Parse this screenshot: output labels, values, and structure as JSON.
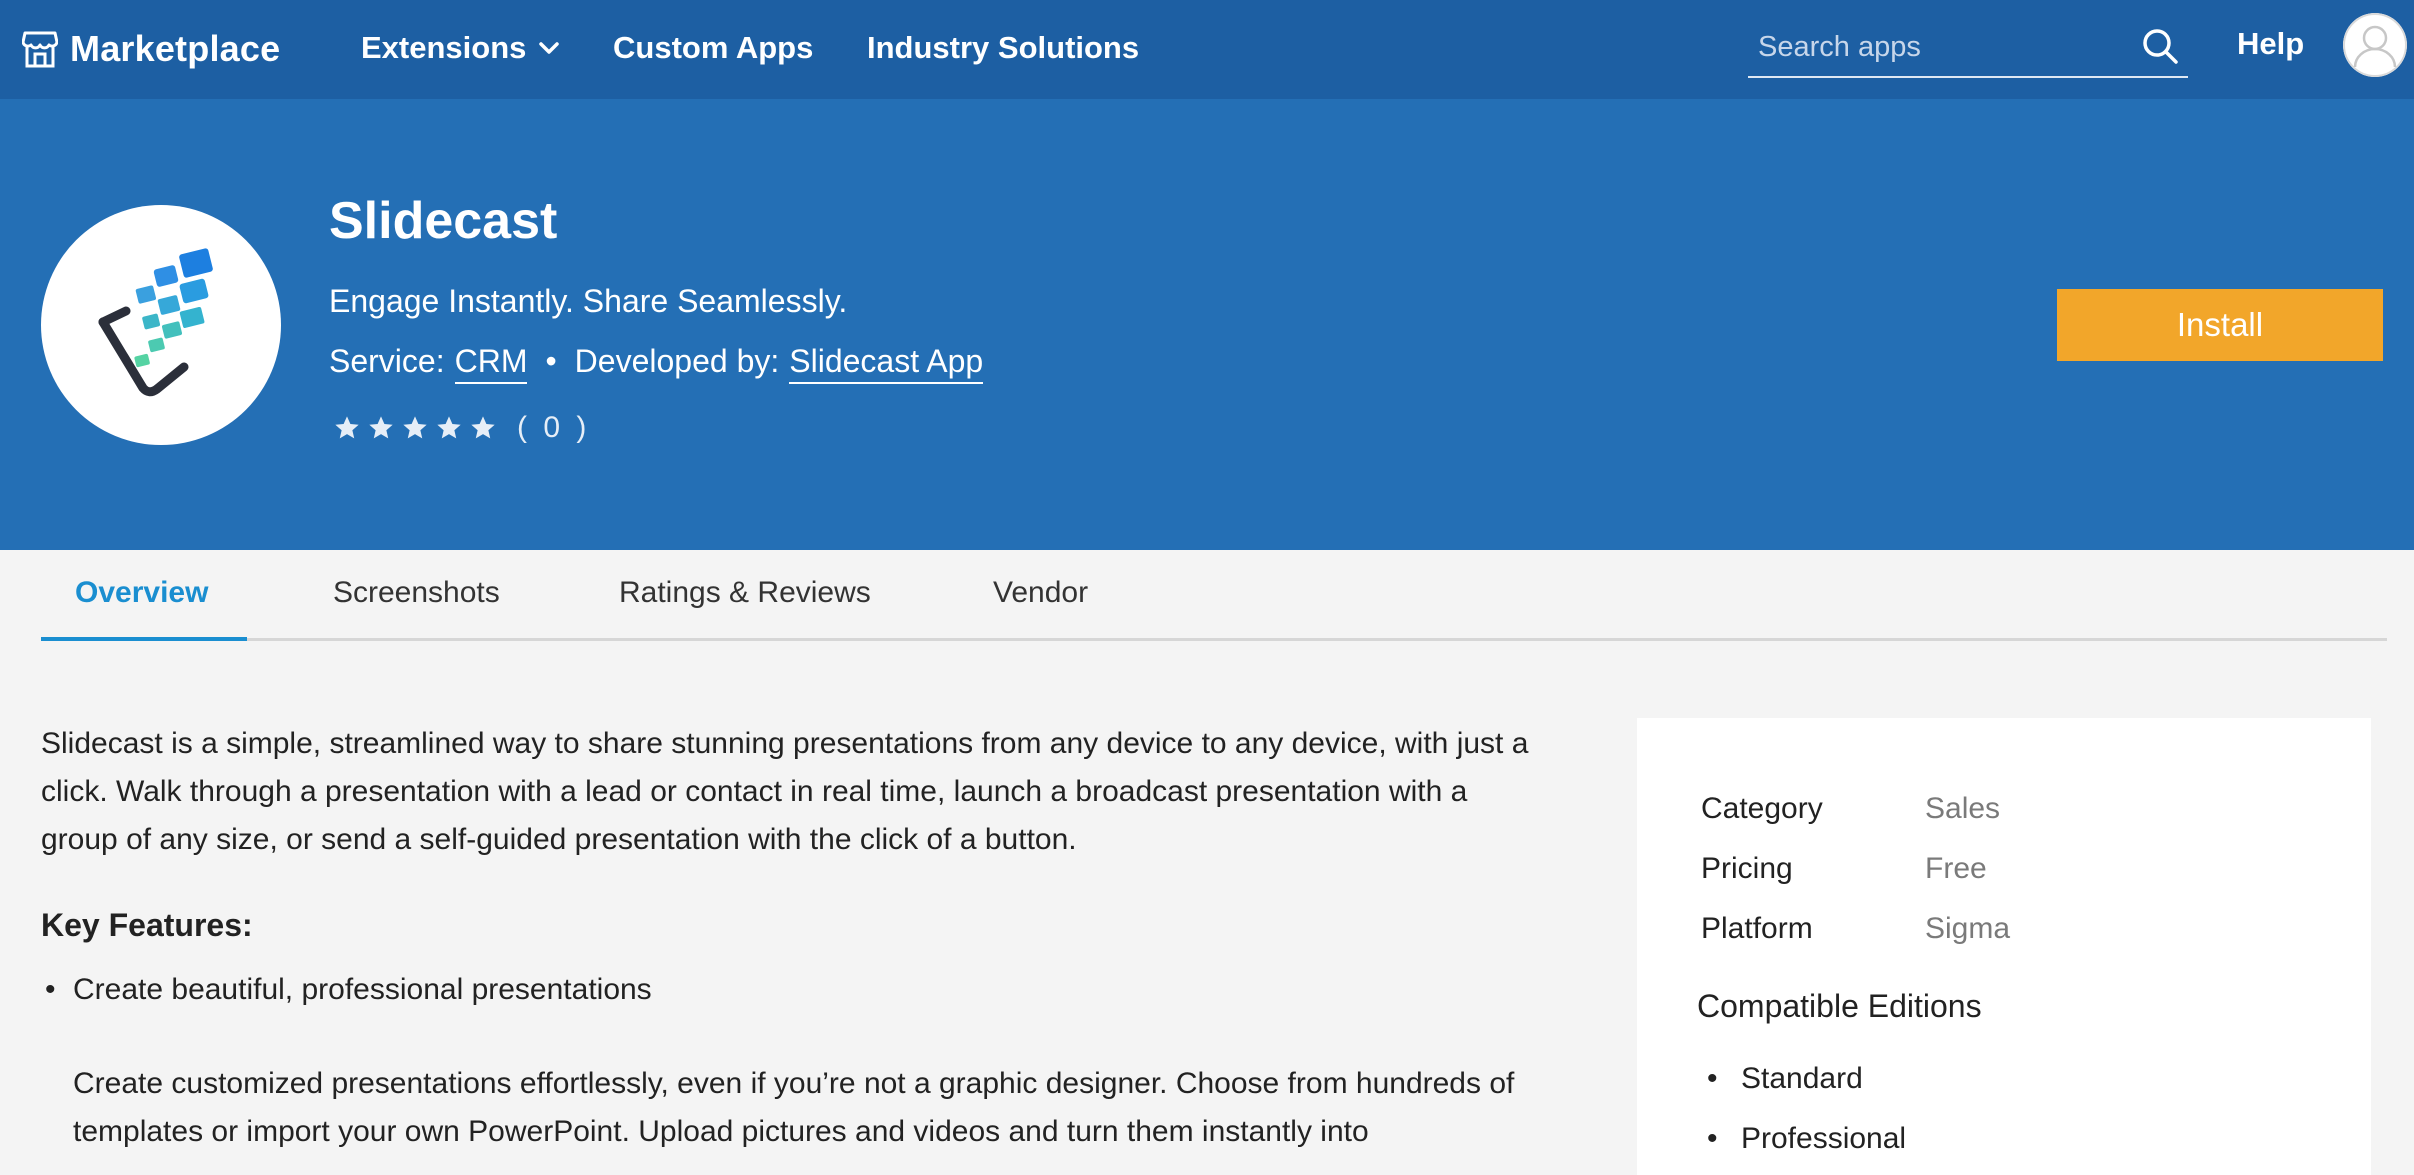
{
  "nav": {
    "brand": "Marketplace",
    "links": [
      "Extensions",
      "Custom Apps",
      "Industry Solutions"
    ],
    "search_placeholder": "Search apps",
    "help": "Help"
  },
  "app": {
    "name": "Slidecast",
    "tagline": "Engage Instantly. Share Seamlessly.",
    "service_label": "Service:",
    "service": "CRM",
    "dot": "•",
    "developer_label": "Developed by:",
    "developer": "Slidecast App",
    "rating_stars": 0,
    "rating_max": 5,
    "rating_count": "( 0 )",
    "install_label": "Install"
  },
  "tabs": [
    "Overview",
    "Screenshots",
    "Ratings & Reviews",
    "Vendor"
  ],
  "overview": {
    "description": "Slidecast is a simple, streamlined way to share stunning presentations from any device to any device, with just a click. Walk through a presentation with a lead or contact in real time, launch a broadcast presentation with a group of any size, or send a self-guided presentation with the click of a button.",
    "features_heading": "Key Features:",
    "features": [
      "Create beautiful, professional presentations"
    ],
    "feature_detail": "Create customized presentations effortlessly, even if you’re not a graphic designer. Choose from hundreds of templates or import your own PowerPoint. Upload pictures and videos and turn them instantly into"
  },
  "details": {
    "rows": [
      {
        "key": "Category",
        "value": "Sales"
      },
      {
        "key": "Pricing",
        "value": "Free"
      },
      {
        "key": "Platform",
        "value": "Sigma"
      }
    ],
    "editions_heading": "Compatible Editions",
    "editions": [
      "Standard",
      "Professional"
    ]
  },
  "colors": {
    "nav_bg": "#1d5fa3",
    "hero_bg": "#246fb5",
    "install_bg": "#f2a62a",
    "tab_active": "#1a8ed0",
    "page_bg": "#f4f4f4"
  }
}
